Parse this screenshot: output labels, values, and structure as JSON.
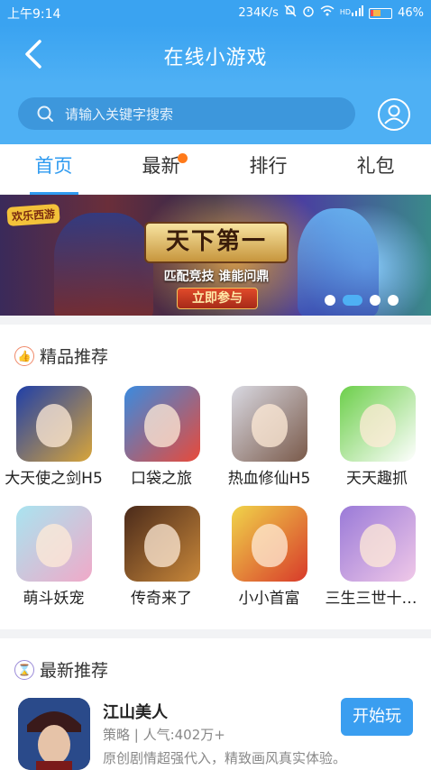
{
  "status_bar": {
    "time": "上午9:14",
    "speed": "234K/s",
    "network_label": "HD",
    "battery": "46%"
  },
  "header": {
    "title": "在线小游戏"
  },
  "search": {
    "placeholder": "请输入关键字搜索"
  },
  "tabs": [
    {
      "label": "首页",
      "active": true
    },
    {
      "label": "最新",
      "active": false,
      "has_badge": true
    },
    {
      "label": "排行",
      "active": false
    },
    {
      "label": "礼包",
      "active": false
    }
  ],
  "banner": {
    "logo_text": "欢乐西游",
    "headline": "天下第一",
    "tagline": "匹配竞技 谁能问鼎",
    "cta": "立即参与",
    "slide_count": 4,
    "active_slide": 2
  },
  "featured": {
    "title": "精品推荐",
    "games": [
      {
        "name": "大天使之剑H5",
        "colors": [
          "#1f3fa8",
          "#d8a53a"
        ]
      },
      {
        "name": "口袋之旅",
        "colors": [
          "#3a8be0",
          "#e84a3a"
        ]
      },
      {
        "name": "热血修仙H5",
        "colors": [
          "#d9d9e2",
          "#7a5a4a"
        ]
      },
      {
        "name": "天天趣抓",
        "colors": [
          "#6ccf4a",
          "#ffffff"
        ]
      },
      {
        "name": "萌斗妖宠",
        "colors": [
          "#a9e4f0",
          "#f0a9c8"
        ]
      },
      {
        "name": "传奇来了",
        "colors": [
          "#4a2a1a",
          "#c9883a"
        ]
      },
      {
        "name": "小小首富",
        "colors": [
          "#f0d44a",
          "#d83a2a"
        ]
      },
      {
        "name": "三生三世十里桃花",
        "colors": [
          "#9a7ad8",
          "#f0c8e8"
        ]
      }
    ]
  },
  "latest": {
    "title": "最新推荐",
    "item": {
      "name": "江山美人",
      "meta": "策略 | 人气:402万+",
      "desc": "原创剧情超强代入，精致画风真实体验。",
      "button": "开始玩"
    }
  },
  "colors": {
    "accent": "#2f9bf0",
    "header": "#3aa3f1",
    "badge": "#ff7a1a"
  }
}
